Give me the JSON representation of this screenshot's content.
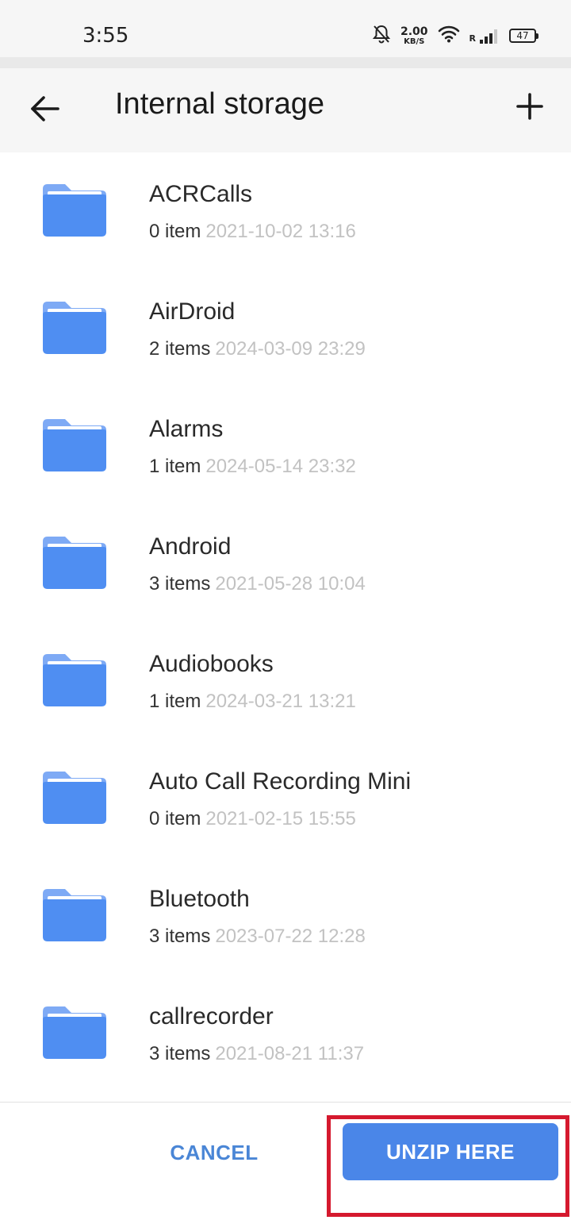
{
  "status_bar": {
    "time": "3:55",
    "net_speed_value": "2.00",
    "net_speed_unit": "KB/S",
    "roaming_label": "R",
    "battery": "47",
    "icons": [
      "mute-bell-icon",
      "wifi-icon",
      "signal-icon",
      "battery-icon"
    ]
  },
  "app_bar": {
    "title": "Internal storage",
    "back_icon": "arrow-left-icon",
    "add_icon": "plus-icon"
  },
  "folders": [
    {
      "name": "ACRCalls",
      "count": "0 item",
      "date": "2021-10-02 13:16"
    },
    {
      "name": "AirDroid",
      "count": "2 items",
      "date": "2024-03-09 23:29"
    },
    {
      "name": "Alarms",
      "count": "1 item",
      "date": "2024-05-14 23:32"
    },
    {
      "name": "Android",
      "count": "3 items",
      "date": "2021-05-28 10:04"
    },
    {
      "name": "Audiobooks",
      "count": "1 item",
      "date": "2024-03-21 13:21"
    },
    {
      "name": "Auto Call Recording Mini",
      "count": "0 item",
      "date": "2021-02-15 15:55"
    },
    {
      "name": "Bluetooth",
      "count": "3 items",
      "date": "2023-07-22 12:28"
    },
    {
      "name": "callrecorder",
      "count": "3 items",
      "date": "2021-08-21 11:37"
    }
  ],
  "actions": {
    "cancel_label": "CANCEL",
    "unzip_label": "UNZIP HERE"
  },
  "colors": {
    "folder": "#4f8ef2",
    "folder_tab": "#7eaaf5",
    "primary_button": "#4a86e8",
    "cancel_text": "#4a86d6",
    "highlight": "#d5192e"
  }
}
